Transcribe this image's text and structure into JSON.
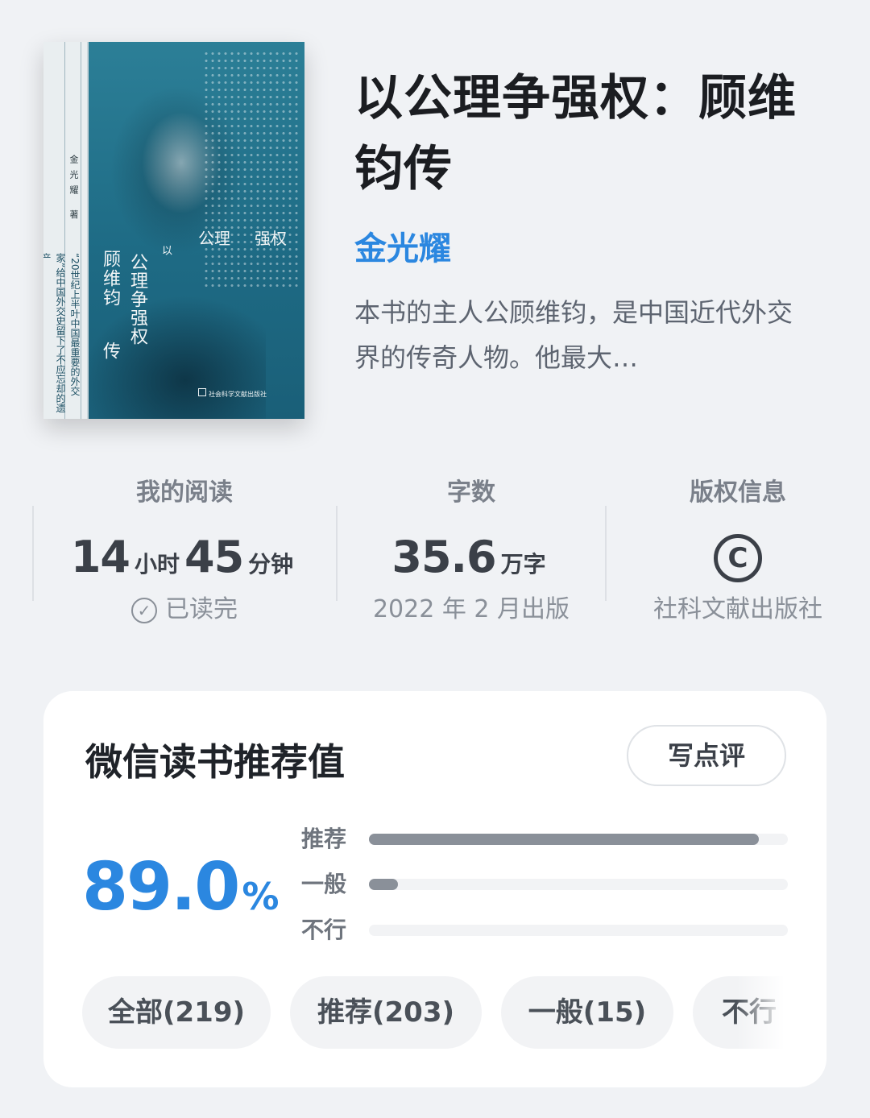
{
  "book": {
    "title": "以公理争强权：顾维钧传",
    "author": "金光耀",
    "intro": "本书的主人公顾维钧，是中国近代外交界的传奇人物。他最大…",
    "cover": {
      "author_vertical": "金光耀 著",
      "tagline": "“20世纪上半叶中国最重要的外交家”给中国外交史留下了不应忘却的遗产",
      "title_row_1": "公理",
      "title_row_2": "强权",
      "title_vertical_1": "顾维钧",
      "title_vertical_2": "公理争强权",
      "title_vertical_3": "以",
      "title_vertical_4": "传",
      "publisher": "社会科学文献出版社"
    }
  },
  "stats": {
    "reading": {
      "label": "我的阅读",
      "hours": "14",
      "hours_unit": "小时",
      "minutes": "45",
      "minutes_unit": "分钟",
      "status": "已读完"
    },
    "words": {
      "label": "字数",
      "value": "35.6",
      "unit": "万字",
      "published": "2022 年 2 月出版"
    },
    "copyright": {
      "label": "版权信息",
      "icon_text": "C",
      "publisher": "社科文献出版社"
    }
  },
  "rating": {
    "title": "微信读书推荐值",
    "write_review": "写点评",
    "score": "89.0",
    "percent_sign": "%",
    "bars": [
      {
        "label": "推荐",
        "fraction": 0.93
      },
      {
        "label": "一般",
        "fraction": 0.07
      },
      {
        "label": "不行",
        "fraction": 0.0
      }
    ],
    "filters": [
      {
        "label": "全部(219)"
      },
      {
        "label": "推荐(203)"
      },
      {
        "label": "一般(15)"
      },
      {
        "label": "不行"
      }
    ]
  },
  "colors": {
    "accent": "#2b87e0",
    "bar_fill": "#8a9099",
    "cover": "#1e6b85"
  }
}
